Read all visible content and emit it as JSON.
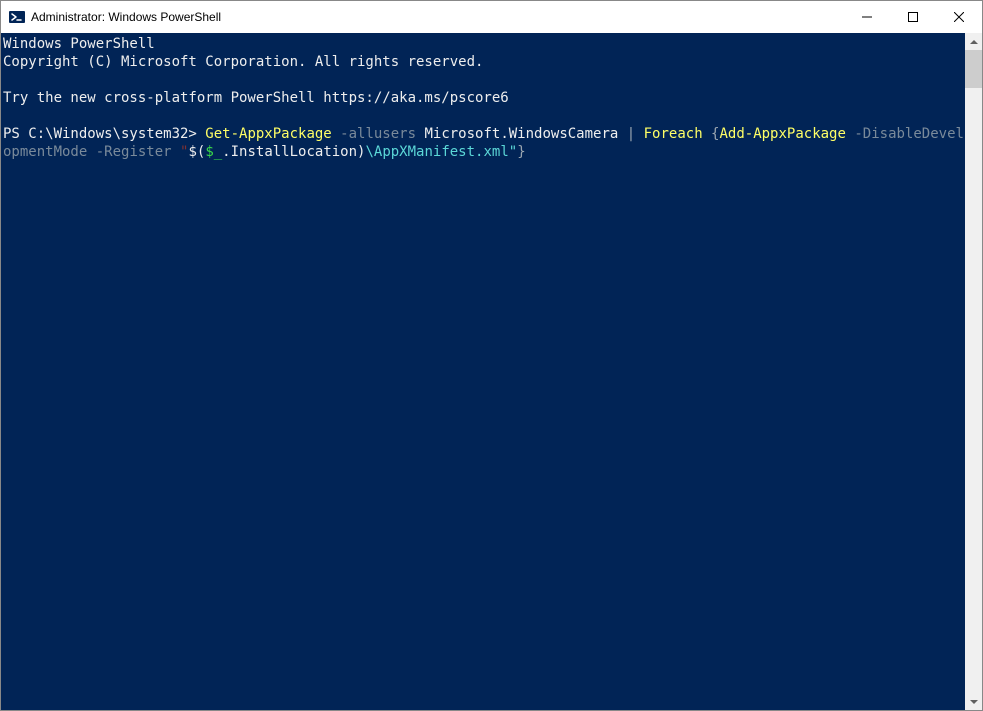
{
  "window": {
    "title": "Administrator: Windows PowerShell"
  },
  "console": {
    "banner_line1": "Windows PowerShell",
    "banner_line2": "Copyright (C) Microsoft Corporation. All rights reserved.",
    "banner_line3": "Try the new cross-platform PowerShell https://aka.ms/pscore6",
    "prompt": "PS C:\\Windows\\system32> ",
    "cmd": {
      "p1": "Get-AppxPackage",
      "p2": " -allusers",
      "p3": " Microsoft.WindowsCamera ",
      "pipe": "|",
      "p4": " Foreach",
      "p5": " {",
      "p6": "Add-AppxPackage",
      "p7a": " -DisableDevelopment",
      "p7b": "Mode",
      "p8": " -Register",
      "p9a": " \"",
      "p9b": "$(",
      "p9c": "$_",
      "p9d": ".InstallLocation",
      "p9e": ")",
      "p10": "\\AppXManifest.xml\"",
      "p11": "}"
    }
  }
}
